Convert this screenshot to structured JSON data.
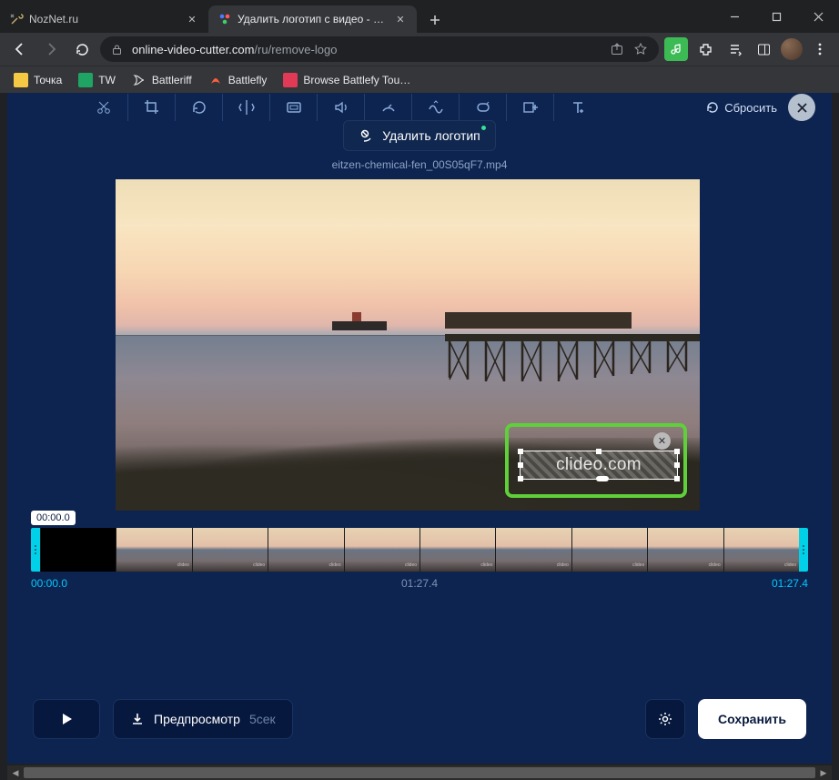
{
  "titlebar": {
    "tabs": [
      {
        "title": "NozNet.ru",
        "active": false
      },
      {
        "title": "Удалить логотип с видео - стер",
        "active": true
      }
    ]
  },
  "toolbar": {
    "url_host": "online-video-cutter.com",
    "url_path": "/ru/remove-logo"
  },
  "bookmarks": [
    {
      "label": "Точка",
      "color": "#f6c945"
    },
    {
      "label": "TW",
      "color": "#1fa463"
    },
    {
      "label": "Battleriff",
      "color": "#ffffff"
    },
    {
      "label": "Battlefly",
      "color": "#ff5f3c"
    },
    {
      "label": "Browse Battlefy Tou…",
      "color": "#e03a56"
    }
  ],
  "app": {
    "reset_label": "Сбросить",
    "remove_logo_label": "Удалить логотип",
    "filename": "eitzen-chemical-fen_00S05qF7.mp4",
    "watermark_text": "clideo.com",
    "tooltip_time": "00:00.0",
    "time_start": "00:00.0",
    "time_mid": "01:27.4",
    "time_end": "01:27.4",
    "preview_label": "Предпросмотр",
    "preview_duration": "5сек",
    "save_label": "Сохранить"
  }
}
